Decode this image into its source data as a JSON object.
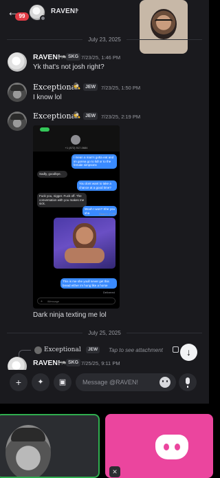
{
  "header": {
    "back_icon": "arrow-left-icon",
    "unread_badge": "99",
    "channel_name": "RAVEN!",
    "chevron": "›"
  },
  "dividers": [
    "July 23, 2025",
    "July 25, 2025"
  ],
  "messages": [
    {
      "author": "RAVEN!",
      "tag": "SKG",
      "timestamp": "7/23/25, 1:46 PM",
      "text": "Yk that's not josh right?"
    },
    {
      "author": "Exceptional",
      "emoji": "🕵️",
      "tag": "JEW",
      "timestamp": "7/23/25, 1:50 PM",
      "text": "I know lol"
    },
    {
      "author": "Exceptional",
      "emoji": "🕵️",
      "tag": "JEW",
      "timestamp": "7/23/25, 2:19 PM",
      "text": "Dark ninja texting me lol"
    }
  ],
  "attachment": {
    "phone_number": "+1 (872) 917-0684",
    "bubbles": [
      {
        "side": "out",
        "text": "I mean a man's gotta eat and im gonna go to lidl or to the female simpsons"
      },
      {
        "side": "in",
        "text": "Sadly, goodbye."
      },
      {
        "side": "out",
        "text": "You dont want to take a chance at a good time?"
      },
      {
        "side": "in",
        "text": "Fuck you, nigger. Fuck off. The conversation with you makes me sick."
      },
      {
        "side": "out",
        "text": "Wooh I won? She you sha"
      },
      {
        "side": "out",
        "text": "This is me she youll never get this bread either im hung like a horse"
      }
    ],
    "delivered": "Read 1:17 PM",
    "delivered2": "Delivered",
    "input_placeholder": "iMessage"
  },
  "reply_preview": {
    "author": "Exceptional",
    "tag": "JEW",
    "text": "Tap to see attachment"
  },
  "last_message": {
    "author": "RAVEN!",
    "tag": "SKG",
    "timestamp": "7/25/25, 9:11 PM"
  },
  "input": {
    "placeholder": "Message @RAVEN!"
  },
  "colors": {
    "background": "#1a1a1e",
    "badge": "#e23b45",
    "discord_card": "#eb459e",
    "active_card_border": "#2fae4f"
  }
}
